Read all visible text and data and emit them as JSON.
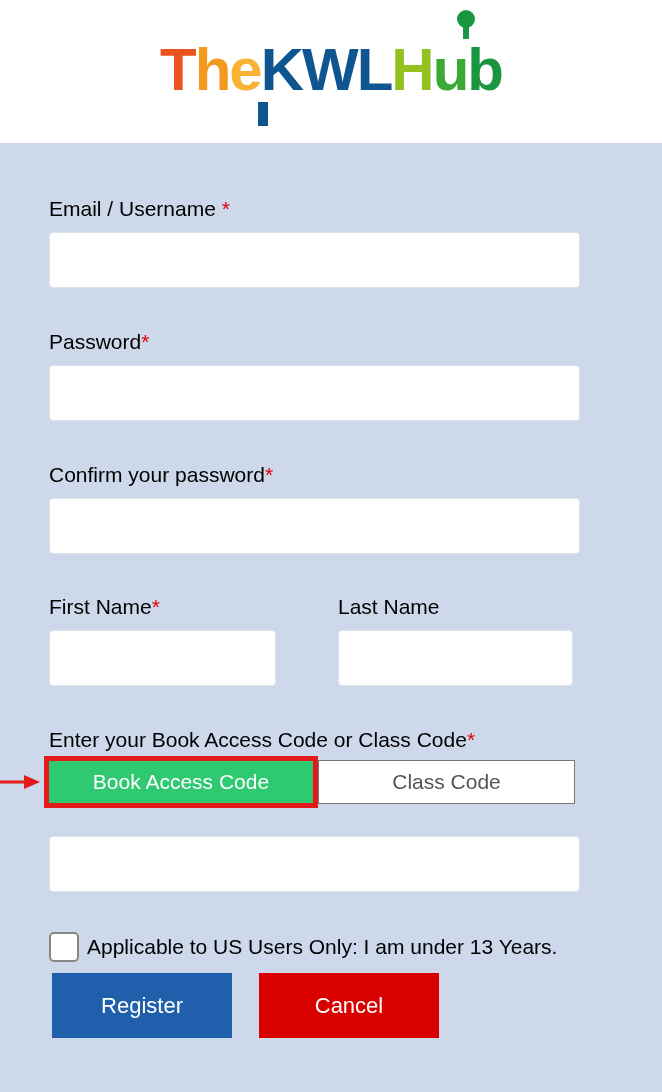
{
  "logo": [
    {
      "text": "T",
      "color": "#e8531e"
    },
    {
      "text": "h",
      "color": "#f39a1c"
    },
    {
      "text": "e",
      "color": "#f9b233"
    },
    {
      "text": "KWL",
      "color": "#0f5690"
    },
    {
      "text": "H",
      "color": "#95c11f"
    },
    {
      "text": "u",
      "color": "#3aaa35"
    },
    {
      "text": "b",
      "color": "#1a9640"
    }
  ],
  "fields": [
    {
      "label": "Email / Username",
      "required_mark": " *"
    },
    {
      "label": "Password",
      "required_mark": "*"
    },
    {
      "label": "Confirm your password",
      "required_mark": "*"
    }
  ],
  "name_fields": [
    {
      "label": "First Name",
      "required_mark": "*"
    },
    {
      "label": "Last Name"
    }
  ],
  "code": {
    "label": "Enter your Book Access Code or Class Code",
    "required_mark": "*",
    "tabs": [
      {
        "label": "Book Access Code",
        "selected": true,
        "highlighted": true
      },
      {
        "label": "Class Code",
        "selected": false,
        "highlighted": false
      }
    ]
  },
  "checkbox": {
    "label": "Applicable to US Users Only: I am under 13 Years.",
    "checked": false
  },
  "buttons": [
    {
      "label": "Register",
      "kind": "primary"
    },
    {
      "label": "Cancel",
      "kind": "danger"
    }
  ]
}
